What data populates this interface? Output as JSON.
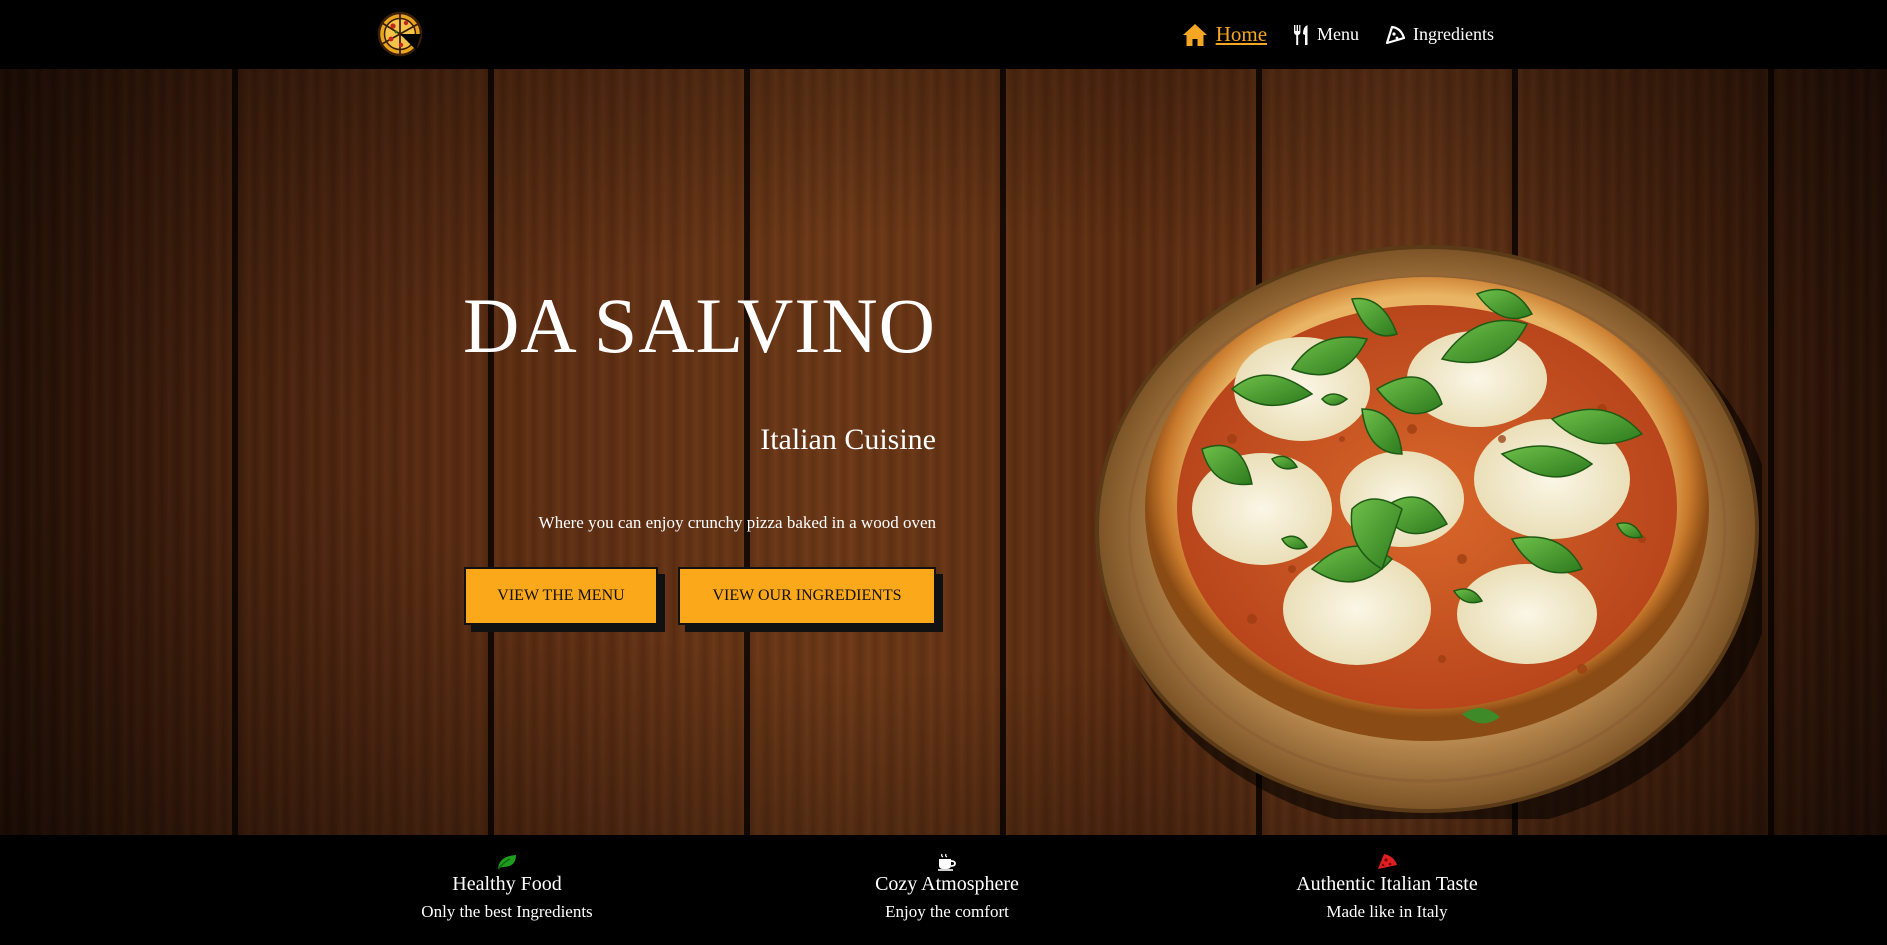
{
  "nav": {
    "logo": "pizza-logo-icon",
    "items": [
      {
        "label": "Home",
        "icon": "home-icon",
        "active": true
      },
      {
        "label": "Menu",
        "icon": "cutlery-icon",
        "active": false
      },
      {
        "label": "Ingredients",
        "icon": "pizza-slice-icon",
        "active": false
      }
    ],
    "accent_color": "#f5a623"
  },
  "hero": {
    "title": "DA SALVINO",
    "subtitle": "Italian Cuisine",
    "tagline": "Where you can enjoy crunchy pizza baked in a wood oven",
    "buttons": {
      "menu": "VIEW THE MENU",
      "ingredients": "VIEW OUR INGREDIENTS"
    },
    "button_color": "#fca81b",
    "image": "pizza-image"
  },
  "features": [
    {
      "icon": "leaf-icon",
      "title": "Healthy Food",
      "desc": "Only the best Ingredients",
      "color": "#1f9d1f"
    },
    {
      "icon": "coffee-cup-icon",
      "title": "Cozy Atmosphere",
      "desc": "Enjoy the comfort",
      "color": "#ffffff"
    },
    {
      "icon": "pizza-slice-icon",
      "title": "Authentic Italian Taste",
      "desc": "Made like in Italy",
      "color": "#e02020"
    }
  ]
}
